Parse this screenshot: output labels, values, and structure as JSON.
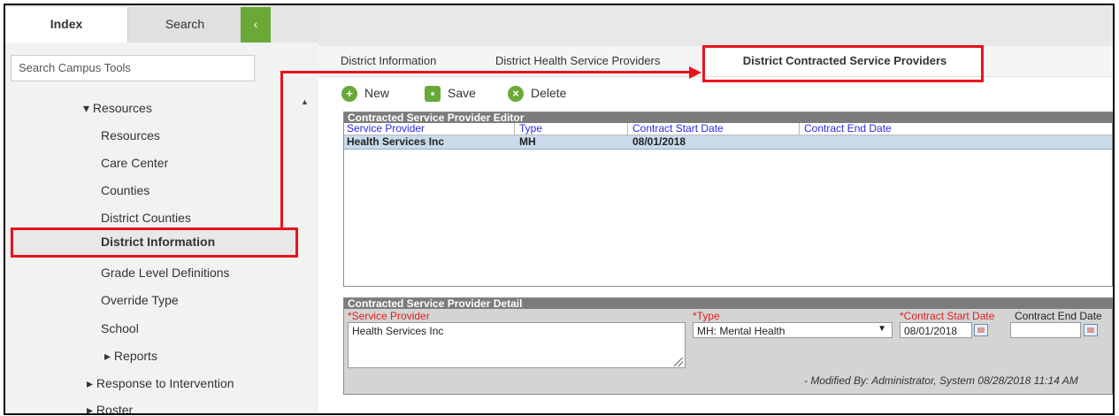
{
  "sidebar": {
    "tab_index": "Index",
    "tab_search": "Search",
    "collapse_glyph": "‹",
    "search_placeholder": "Search Campus Tools",
    "tree": [
      {
        "label": "▾ Resources"
      },
      {
        "label": "Resources"
      },
      {
        "label": "Care Center"
      },
      {
        "label": "Counties"
      },
      {
        "label": "District Counties"
      },
      {
        "label": "District Information",
        "selected": true
      },
      {
        "label": "Grade Level Definitions"
      },
      {
        "label": "Override Type"
      },
      {
        "label": "School"
      },
      {
        "label": "▸ Reports"
      },
      {
        "label": "▸ Response to Intervention"
      },
      {
        "label": "▸ Roster"
      }
    ],
    "scroll_up_glyph": "▲"
  },
  "subtabs": [
    "District Information",
    "District Health Service Providers",
    "District Contracted Service Providers"
  ],
  "toolbar": {
    "new_label": "New",
    "save_label": "Save",
    "delete_label": "Delete",
    "new_glyph": "+",
    "save_glyph": "▪",
    "delete_glyph": "×"
  },
  "editor": {
    "title": "Contracted Service Provider Editor",
    "columns": [
      "Service Provider",
      "Type",
      "Contract Start Date",
      "Contract End Date"
    ],
    "rows": [
      {
        "provider": "Health Services Inc",
        "type": "MH",
        "start": "08/01/2018",
        "end": ""
      }
    ]
  },
  "detail": {
    "title": "Contracted Service Provider Detail",
    "provider_label": "*Service Provider",
    "provider_value": "Health Services Inc",
    "type_label": "*Type",
    "type_value": "MH: Mental Health",
    "start_label": "*Contract Start Date",
    "start_value": "08/01/2018",
    "end_label": "Contract End Date",
    "end_value": "",
    "select_arrow": "▼",
    "modified": "- Modified By: Administrator, System 08/28/2018 11:14 AM"
  },
  "colors": {
    "accent_green": "#6aa938",
    "annotation_red": "#e8141c",
    "link_blue": "#2a2ae0",
    "selected_row": "#c9dbea"
  }
}
